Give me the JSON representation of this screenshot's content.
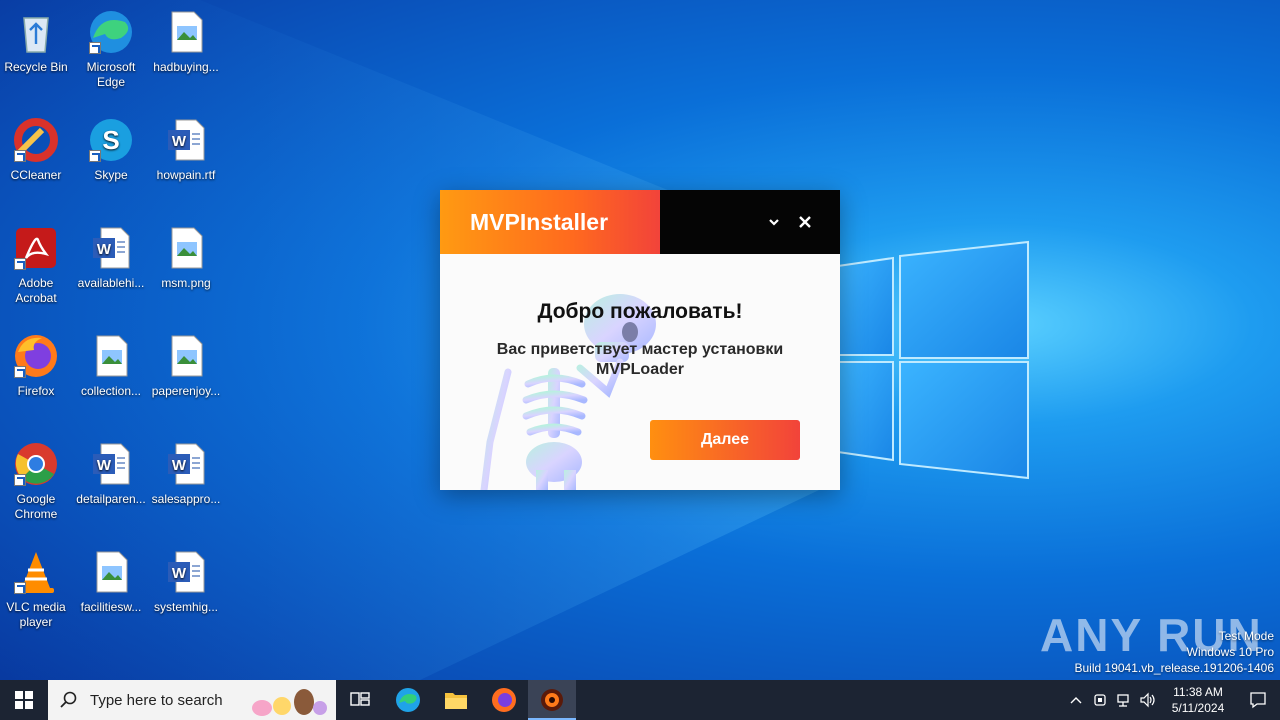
{
  "desktop": {
    "icons": [
      {
        "label": "Recycle Bin",
        "icon": "recycle-bin-icon"
      },
      {
        "label": "Microsoft Edge",
        "icon": "edge-icon"
      },
      {
        "label": "hadbuying...",
        "icon": "image-file-icon"
      },
      {
        "label": "CCleaner",
        "icon": "ccleaner-icon"
      },
      {
        "label": "Skype",
        "icon": "skype-icon"
      },
      {
        "label": "howpain.rtf",
        "icon": "word-document-icon"
      },
      {
        "label": "Adobe Acrobat",
        "icon": "acrobat-icon"
      },
      {
        "label": "availablehi...",
        "icon": "word-document-icon"
      },
      {
        "label": "msm.png",
        "icon": "image-file-icon"
      },
      {
        "label": "Firefox",
        "icon": "firefox-icon"
      },
      {
        "label": "collection...",
        "icon": "image-file-icon"
      },
      {
        "label": "paperenjoy...",
        "icon": "image-file-icon"
      },
      {
        "label": "Google Chrome",
        "icon": "chrome-icon"
      },
      {
        "label": "detailparen...",
        "icon": "word-document-icon"
      },
      {
        "label": "salesappro...",
        "icon": "word-document-icon"
      },
      {
        "label": "VLC media player",
        "icon": "vlc-icon"
      },
      {
        "label": "facilitiesw...",
        "icon": "image-file-icon"
      },
      {
        "label": "systemhig...",
        "icon": "word-document-icon"
      }
    ]
  },
  "installer": {
    "brand": "MVPInstaller",
    "title": "Добро пожаловать!",
    "subtitle_line1": "Вас приветствует мастер установки",
    "subtitle_line2": "MVPLoader",
    "next_label": "Далее"
  },
  "watermark": {
    "logo_text": "ANY RUN",
    "line1": "Test Mode",
    "line2": "Windows 10 Pro",
    "line3": "Build 19041.vb_release.191206-1406"
  },
  "taskbar": {
    "search_placeholder": "Type here to search",
    "time": "11:38 AM",
    "date": "5/11/2024"
  },
  "colors": {
    "accent_orange": "#ff9a12",
    "accent_red": "#f2433a",
    "taskbar": "#1c2433"
  }
}
